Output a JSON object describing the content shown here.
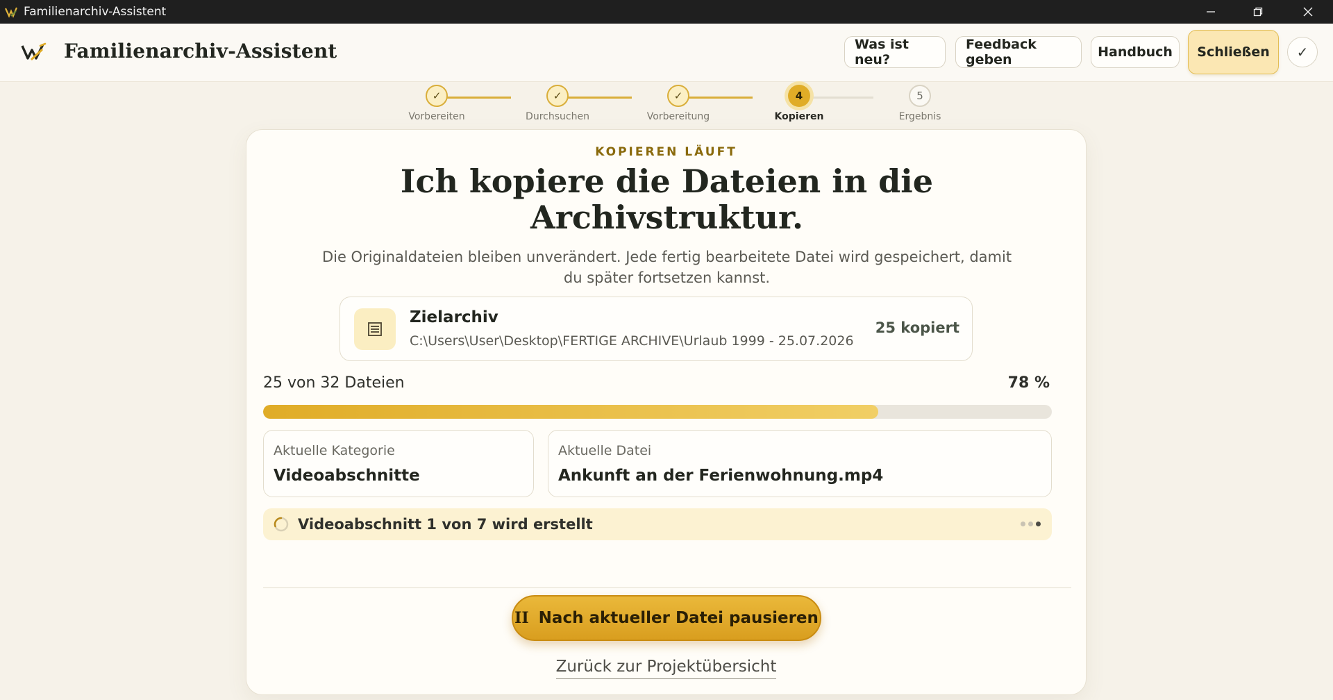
{
  "window": {
    "title": "Familienarchiv-Assistent",
    "controls": [
      "minimize-icon",
      "restore-icon",
      "close-icon"
    ]
  },
  "header": {
    "app_title": "Familienarchiv-Assistent",
    "buttons": {
      "whats_new": "Was ist neu?",
      "feedback": "Feedback geben",
      "manual": "Handbuch",
      "close": "Schließen",
      "check": "✓"
    }
  },
  "stepper": {
    "steps": [
      {
        "label": "Vorbereiten",
        "state": "done",
        "marker": "✓"
      },
      {
        "label": "Durchsuchen",
        "state": "done",
        "marker": "✓"
      },
      {
        "label": "Vorbereitung",
        "state": "done",
        "marker": "✓"
      },
      {
        "label": "Kopieren",
        "state": "active",
        "marker": "4"
      },
      {
        "label": "Ergebnis",
        "state": "pending",
        "marker": "5"
      }
    ]
  },
  "main": {
    "eyebrow": "KOPIEREN LÄUFT",
    "headline": "Ich kopiere die Dateien in die Archivstruktur.",
    "subtext": "Die Originaldateien bleiben unverändert. Jede fertig bearbeitete Datei wird gespeichert, damit du später fortsetzen kannst.",
    "target": {
      "title": "Zielarchiv",
      "path": "C:\\Users\\User\\Desktop\\FERTIGE ARCHIVE\\Urlaub 1999 - 25.07.2026",
      "count": "25 kopiert",
      "icon": "archive-icon"
    },
    "progress": {
      "label": "25 von 32 Dateien",
      "percent_text": "78 %",
      "fraction": 0.78
    },
    "current_category": {
      "label": "Aktuelle Kategorie",
      "value": "Videoabschnitte"
    },
    "current_file": {
      "label": "Aktuelle Datei",
      "value": "Ankunft an der Ferienwohnung.mp4"
    },
    "status": {
      "text": "Videoabschnitt 1 von 7 wird erstellt",
      "icon": "spinner-icon"
    },
    "pause_button": {
      "icon": "II",
      "label": "Nach aktueller Datei pausieren"
    },
    "back_link": "Zurück zur Projektübersicht"
  },
  "colors": {
    "accent": "#e0ac27",
    "accent_light": "#fbe7b3",
    "background": "#f6f2e9",
    "card": "#fffdf8",
    "eyebrow": "#8a6a0c"
  }
}
